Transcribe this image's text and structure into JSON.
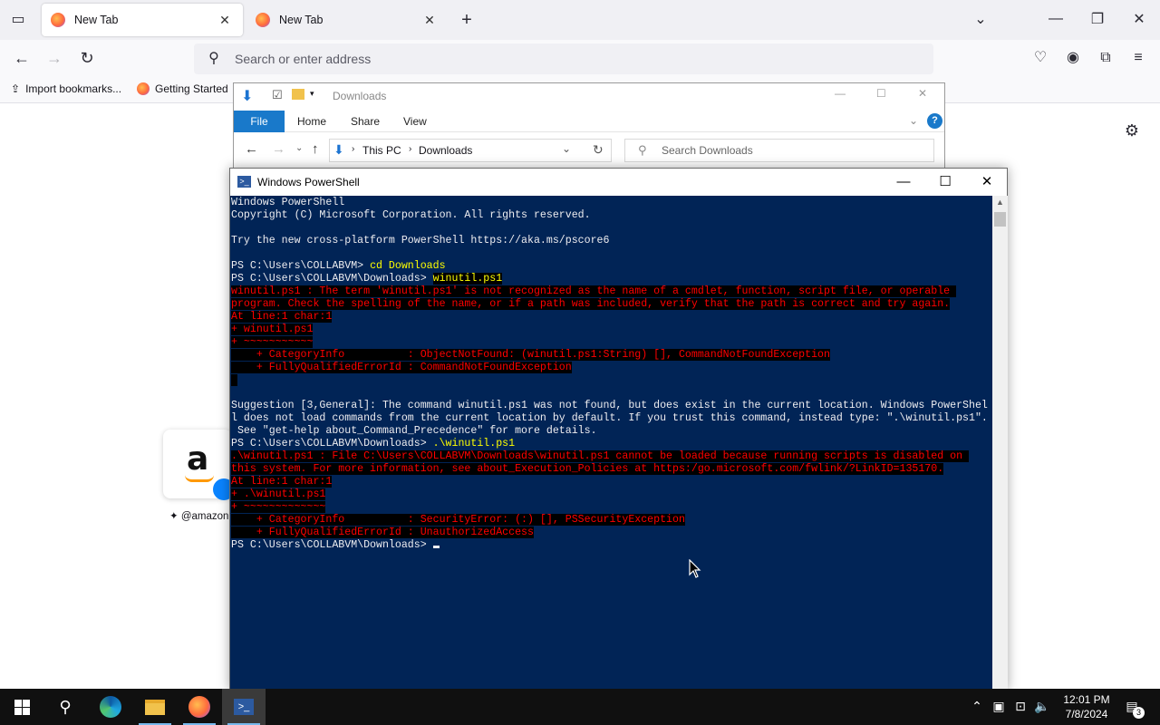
{
  "firefox": {
    "tabs": [
      {
        "label": "New Tab",
        "active": true
      },
      {
        "label": "New Tab",
        "active": false
      }
    ],
    "urlbar_placeholder": "Search or enter address",
    "bookmarks": [
      {
        "label": "Import bookmarks..."
      },
      {
        "label": "Getting Started"
      }
    ],
    "shortcut_label": "@amazon"
  },
  "explorer": {
    "title": "Downloads",
    "ribbon_tabs": [
      "File",
      "Home",
      "Share",
      "View"
    ],
    "breadcrumb": [
      "This PC",
      "Downloads"
    ],
    "search_placeholder": "Search Downloads"
  },
  "powershell": {
    "title": "Windows PowerShell",
    "lines": [
      {
        "kind": "out",
        "text": "Windows PowerShell"
      },
      {
        "kind": "out",
        "text": "Copyright (C) Microsoft Corporation. All rights reserved."
      },
      {
        "kind": "out",
        "text": ""
      },
      {
        "kind": "out",
        "text": "Try the new cross-platform PowerShell https://aka.ms/pscore6"
      },
      {
        "kind": "out",
        "text": ""
      },
      {
        "kind": "cmd",
        "prompt": "PS C:\\Users\\COLLABVM> ",
        "command": "cd Downloads",
        "highlight": false
      },
      {
        "kind": "cmd",
        "prompt": "PS C:\\Users\\COLLABVM\\Downloads> ",
        "command": "winutil.ps1",
        "highlight": true
      },
      {
        "kind": "err",
        "text": "winutil.ps1 : The term 'winutil.ps1' is not recognized as the name of a cmdlet, function, script file, or operable "
      },
      {
        "kind": "err",
        "text": "program. Check the spelling of the name, or if a path was included, verify that the path is correct and try again."
      },
      {
        "kind": "err",
        "text": "At line:1 char:1"
      },
      {
        "kind": "err",
        "text": "+ winutil.ps1"
      },
      {
        "kind": "err",
        "text": "+ ~~~~~~~~~~~"
      },
      {
        "kind": "err",
        "text": "    + CategoryInfo          : ObjectNotFound: (winutil.ps1:String) [], CommandNotFoundException"
      },
      {
        "kind": "err",
        "text": "    + FullyQualifiedErrorId : CommandNotFoundException"
      },
      {
        "kind": "err",
        "text": " "
      },
      {
        "kind": "out",
        "text": ""
      },
      {
        "kind": "out",
        "text": "Suggestion [3,General]: The command winutil.ps1 was not found, but does exist in the current location. Windows PowerShel"
      },
      {
        "kind": "out",
        "text": "l does not load commands from the current location by default. If you trust this command, instead type: \".\\winutil.ps1\"."
      },
      {
        "kind": "out",
        "text": " See \"get-help about_Command_Precedence\" for more details."
      },
      {
        "kind": "cmd",
        "prompt": "PS C:\\Users\\COLLABVM\\Downloads> ",
        "command": ".\\winutil.ps1",
        "highlight": false
      },
      {
        "kind": "err",
        "text": ".\\winutil.ps1 : File C:\\Users\\COLLABVM\\Downloads\\winutil.ps1 cannot be loaded because running scripts is disabled on "
      },
      {
        "kind": "err",
        "text": "this system. For more information, see about_Execution_Policies at https:/go.microsoft.com/fwlink/?LinkID=135170."
      },
      {
        "kind": "err",
        "text": "At line:1 char:1"
      },
      {
        "kind": "err",
        "text": "+ .\\winutil.ps1"
      },
      {
        "kind": "err",
        "text": "+ ~~~~~~~~~~~~~"
      },
      {
        "kind": "err",
        "text": "    + CategoryInfo          : SecurityError: (:) [], PSSecurityException"
      },
      {
        "kind": "err",
        "text": "    + FullyQualifiedErrorId : UnauthorizedAccess"
      },
      {
        "kind": "prompt",
        "text": "PS C:\\Users\\COLLABVM\\Downloads> "
      }
    ]
  },
  "taskbar": {
    "time": "12:01 PM",
    "date": "7/8/2024",
    "notification_count": "3"
  },
  "colors": {
    "console_bg": "#012456",
    "console_fg": "#eeedf0",
    "console_error": "#ff0000",
    "console_command": "#ffff00",
    "explorer_file_tab": "#1979ca",
    "taskbar_bg": "#101010"
  }
}
